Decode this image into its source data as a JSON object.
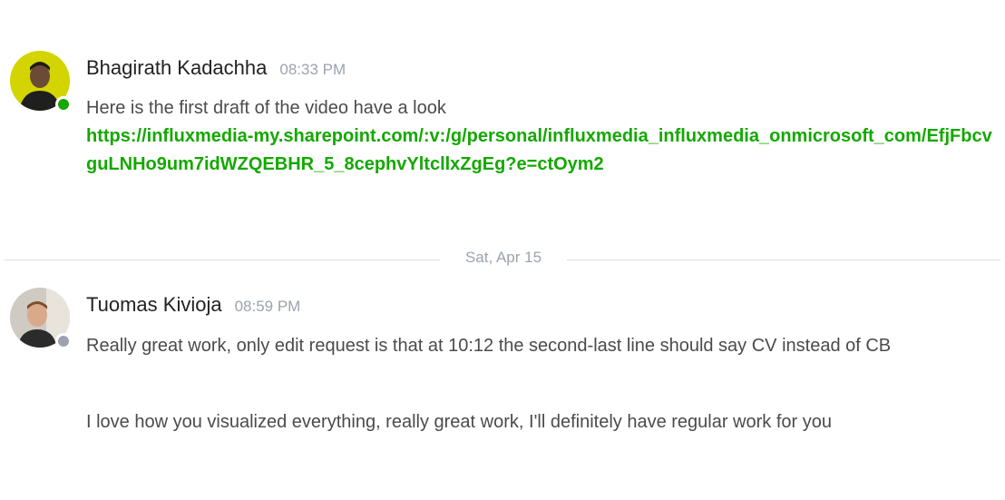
{
  "messages": [
    {
      "author": "Bhagirath Kadachha",
      "time": "08:33 PM",
      "status": "online",
      "status_color": "#14a800",
      "text": "Here is the first draft of the video have a look",
      "link": "https://influxmedia-my.sharepoint.com/:v:/g/personal/influxmedia_influxmedia_onmicrosoft_com/EfjFbcvguLNHo9um7idWZQEBHR_5_8cephvYltcllxZgEg?e=ctOym2"
    },
    {
      "author": "Tuomas Kivioja",
      "time": "08:59 PM",
      "status": "offline",
      "status_color": "#9ca3af",
      "text1": "Really great work, only edit request is that at 10:12 the second-last line should say CV instead of CB",
      "text2": "I love how you visualized everything, really great work, I'll definitely have regular work for you"
    }
  ],
  "date_divider": "Sat, Apr 15",
  "colors": {
    "link": "#14a800",
    "muted": "#9ca3af"
  }
}
